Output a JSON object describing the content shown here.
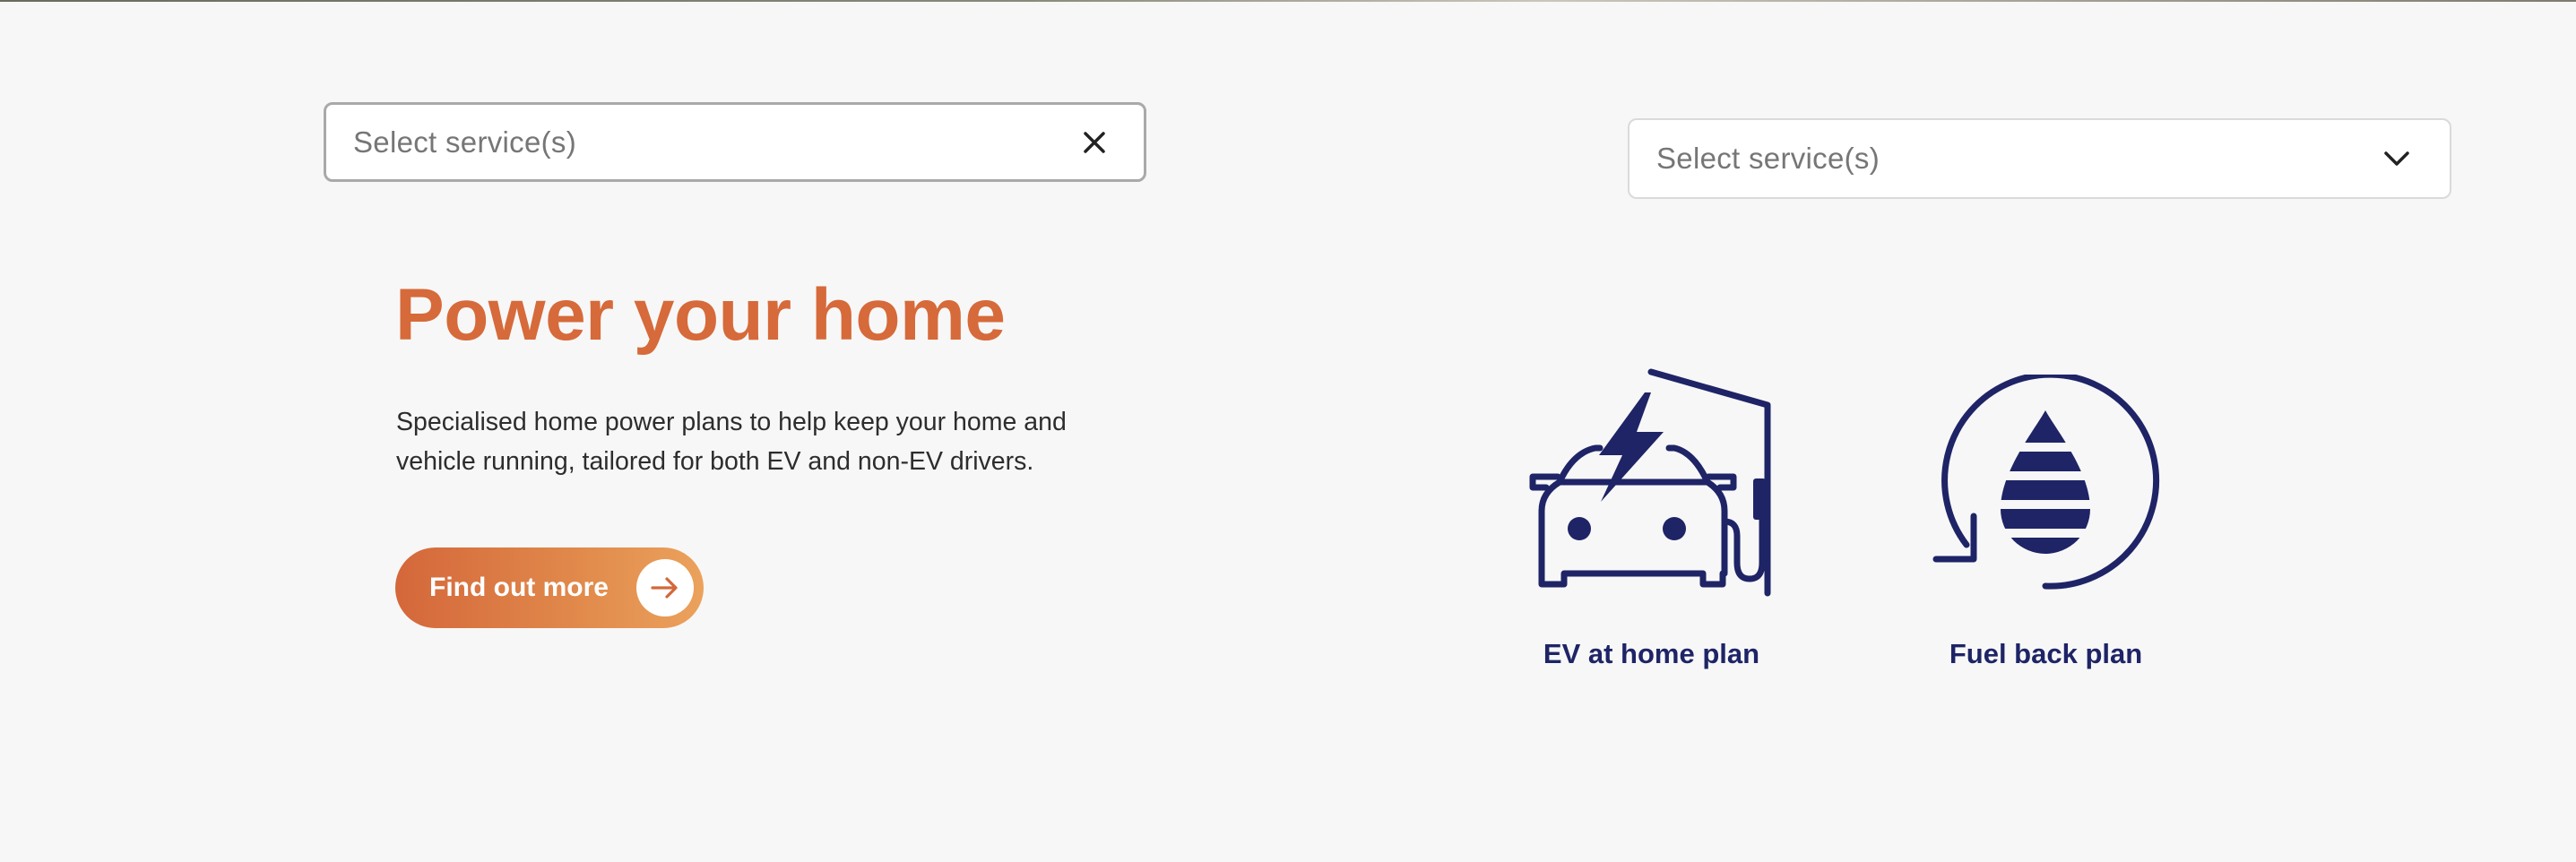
{
  "filters": {
    "left": {
      "placeholder": "Select service(s)",
      "action_icon": "close-icon"
    },
    "right": {
      "placeholder": "Select service(s)",
      "action_icon": "chevron-down-icon"
    }
  },
  "hero": {
    "title": "Power your home",
    "description": "Specialised home power plans to help keep your home and vehicle running, tailored for both EV and non-EV drivers.",
    "cta_label": "Find out more",
    "cta_icon": "arrow-right-icon"
  },
  "plans": [
    {
      "label": "EV at home plan",
      "icon": "ev-charging-car-icon"
    },
    {
      "label": "Fuel back plan",
      "icon": "fuel-drop-cycle-icon"
    }
  ],
  "colors": {
    "accent": "#d66a3a",
    "accent_light": "#eba25c",
    "navy": "#1e2466",
    "background": "#f7f7f7"
  }
}
